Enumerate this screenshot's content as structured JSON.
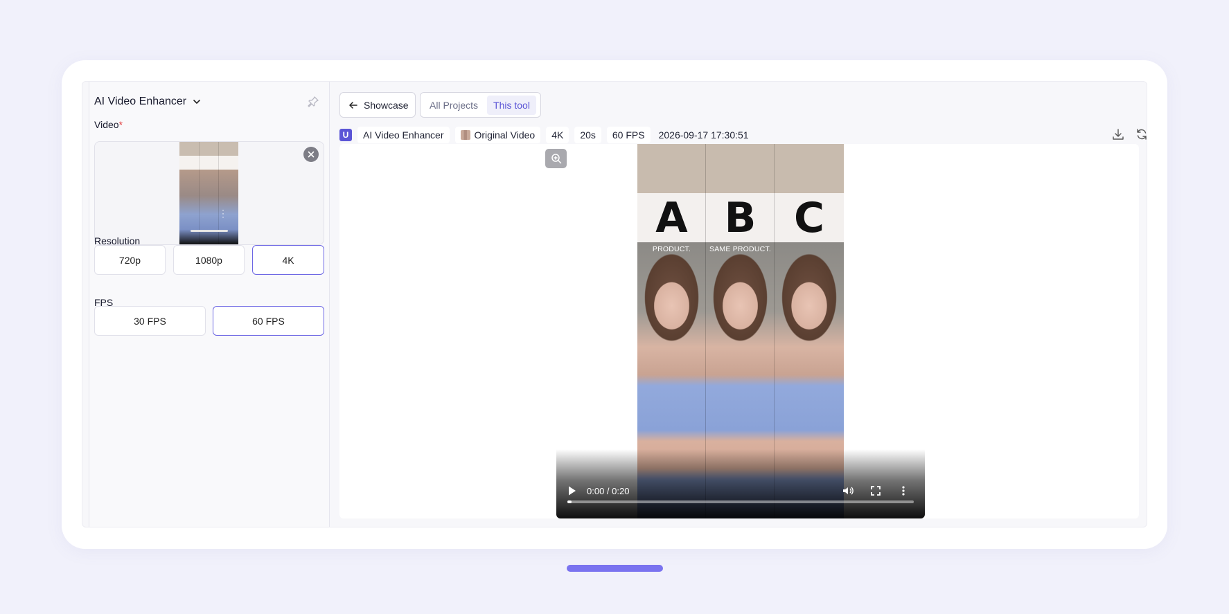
{
  "sidebar": {
    "tool_title": "AI Video Enhancer",
    "video_label": "Video",
    "required_mark": "*",
    "resolution_label": "Resolution",
    "resolution_options": [
      "720p",
      "1080p",
      "4K"
    ],
    "resolution_selected": "4K",
    "fps_label": "FPS",
    "fps_options": [
      "30 FPS",
      "60 FPS"
    ],
    "fps_selected": "60 FPS"
  },
  "header": {
    "back_label": "Showcase",
    "tabs": [
      "All Projects",
      "This tool"
    ],
    "active_tab": "This tool"
  },
  "meta": {
    "badge": "U",
    "tool_name": "AI Video Enhancer",
    "source": "Original Video",
    "resolution": "4K",
    "duration": "20s",
    "fps": "60 FPS",
    "timestamp": "2026-09-17 17:30:51"
  },
  "video": {
    "panels": [
      {
        "letter": "A",
        "caption": "PRODUCT."
      },
      {
        "letter": "B",
        "caption": "SAME PRODUCT."
      },
      {
        "letter": "C",
        "caption": ""
      }
    ],
    "current_time": "0:00",
    "total_time": "0:20",
    "progress": 0.01
  },
  "colors": {
    "accent": "#5b55d6",
    "selected_border": "#6d67e4",
    "home_indicator": "#7a73ef",
    "required": "#e23b3b"
  },
  "icons": {
    "title_dropdown": "chevron-down-icon",
    "pin": "pin-icon",
    "remove": "close-icon",
    "back": "arrow-left-icon",
    "download": "download-icon",
    "refresh": "refresh-icon",
    "zoom": "zoom-in-icon",
    "play": "play-icon",
    "volume": "volume-icon",
    "fullscreen": "fullscreen-icon",
    "more": "more-vertical-icon"
  }
}
